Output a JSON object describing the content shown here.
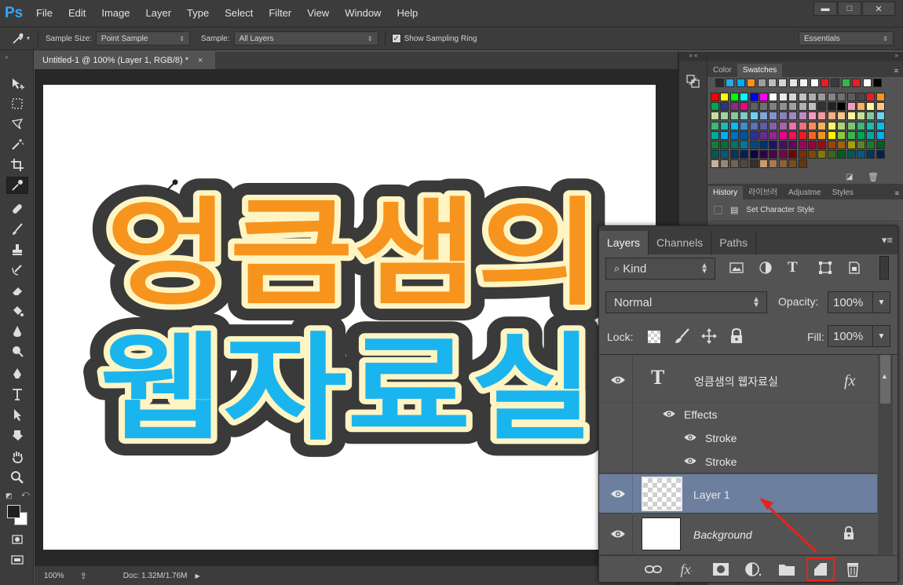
{
  "app": {
    "logo": "Ps"
  },
  "menu": [
    "File",
    "Edit",
    "Image",
    "Layer",
    "Type",
    "Select",
    "Filter",
    "View",
    "Window",
    "Help"
  ],
  "window_controls": {
    "minimize": "▬",
    "maximize": "□",
    "close": "✕"
  },
  "options": {
    "sample_size_label": "Sample Size:",
    "sample_size_value": "Point Sample",
    "sample_label": "Sample:",
    "sample_value": "All Layers",
    "show_ring_label": "Show Sampling Ring",
    "workspace": "Essentials"
  },
  "document": {
    "tab_title": "Untitled-1 @ 100% (Layer 1, RGB/8) *",
    "tab_close": "×",
    "line1": "엉큼샘의",
    "line2": "웹자료실"
  },
  "status": {
    "zoom": "100%",
    "doc": "Doc: 1.32M/1.76M"
  },
  "color_panel": {
    "tabs": [
      "Color",
      "Swatches"
    ],
    "active": "Swatches"
  },
  "history_panel": {
    "tabs": [
      "History",
      "라이브러",
      "Adjustme",
      "Styles"
    ],
    "active": "History",
    "items": [
      "Set Character Style"
    ]
  },
  "layers_panel": {
    "tabs": [
      "Layers",
      "Channels",
      "Paths"
    ],
    "active": "Layers",
    "filter": "Kind",
    "blend_mode": "Normal",
    "opacity_label": "Opacity:",
    "opacity": "100%",
    "lock_label": "Lock:",
    "fill_label": "Fill:",
    "fill": "100%",
    "layers": [
      {
        "name": "엉큼샘의 웹자료실",
        "type": "text",
        "fx": "fx",
        "effects_label": "Effects",
        "effects": [
          "Stroke",
          "Stroke"
        ]
      },
      {
        "name": "Layer 1",
        "type": "pixel",
        "selected": true
      },
      {
        "name": "Background",
        "type": "background",
        "locked": true
      }
    ]
  },
  "colors": {
    "ui_dark": "#3c3c3c",
    "ui_mid": "#535353",
    "selected_layer": "#6c7f9e",
    "text_orange": "#f7941d",
    "text_gray": "#a8a8a8",
    "text_blue": "#1ab5ee",
    "inner_stroke": "#fff5c4",
    "outer_stroke": "#3a3a3a",
    "annotation_red": "#e8231d"
  }
}
